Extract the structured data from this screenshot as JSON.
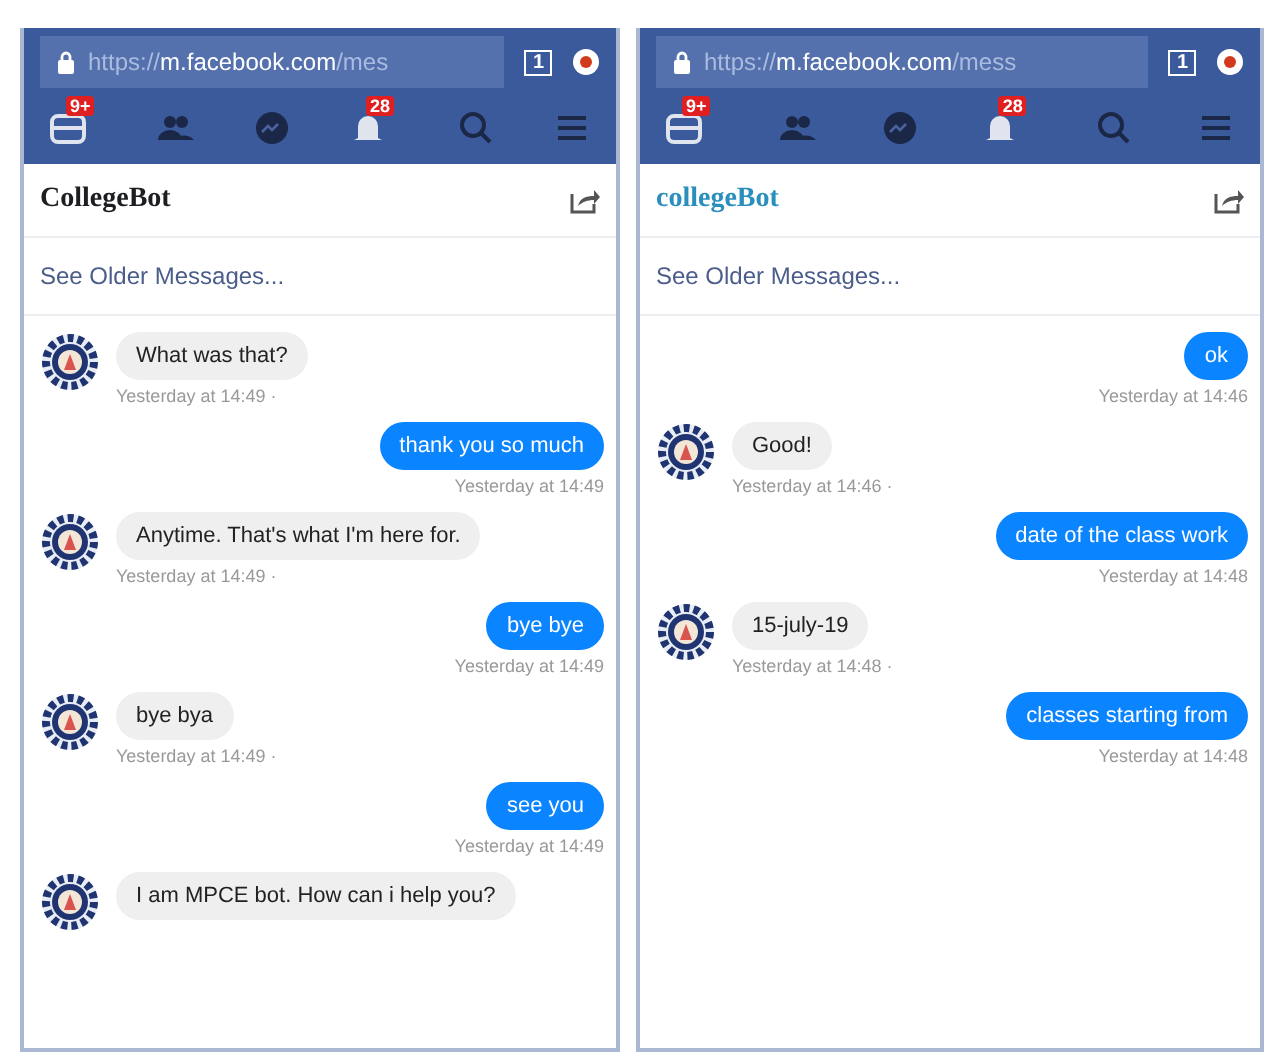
{
  "phones": [
    {
      "address": {
        "scheme": "https://",
        "host": "m.facebook.com",
        "path": "/mes"
      },
      "tab_count": "1",
      "badges": {
        "feed": "9+",
        "notifications": "28"
      },
      "title": {
        "text": "CollegeBot",
        "color": "#1c1e21"
      },
      "older_link": "See Older Messages...",
      "messages": [
        {
          "kind": "received",
          "text": "What was that?",
          "time": "Yesterday at 14:49 ·"
        },
        {
          "kind": "sent",
          "text": "thank you so much",
          "time": "Yesterday at 14:49"
        },
        {
          "kind": "received",
          "text": "Anytime. That's what I'm here for.",
          "time": "Yesterday at 14:49 ·"
        },
        {
          "kind": "sent",
          "text": "bye bye",
          "time": "Yesterday at 14:49"
        },
        {
          "kind": "received",
          "text": "bye bya",
          "time": "Yesterday at 14:49 ·"
        },
        {
          "kind": "sent",
          "text": "see you",
          "time": "Yesterday at 14:49"
        },
        {
          "kind": "received",
          "text": "I am MPCE bot. How can i help you?"
        }
      ]
    },
    {
      "address": {
        "scheme": "https://",
        "host": "m.facebook.com",
        "path": "/mess"
      },
      "tab_count": "1",
      "badges": {
        "feed": "9+",
        "notifications": "28"
      },
      "title": {
        "text": "collegeBot",
        "color": "#2a8fbd"
      },
      "older_link": "See Older Messages...",
      "messages": [
        {
          "kind": "sent",
          "text": "ok",
          "time": "Yesterday at 14:46"
        },
        {
          "kind": "received",
          "text": "Good!",
          "time": "Yesterday at 14:46 ·"
        },
        {
          "kind": "sent",
          "text": "date of the class work",
          "time": "Yesterday at 14:48"
        },
        {
          "kind": "received",
          "text": "15-july-19",
          "time": "Yesterday at 14:48 ·"
        },
        {
          "kind": "sent",
          "text": "classes starting from",
          "time": "Yesterday at 14:48"
        }
      ]
    }
  ]
}
